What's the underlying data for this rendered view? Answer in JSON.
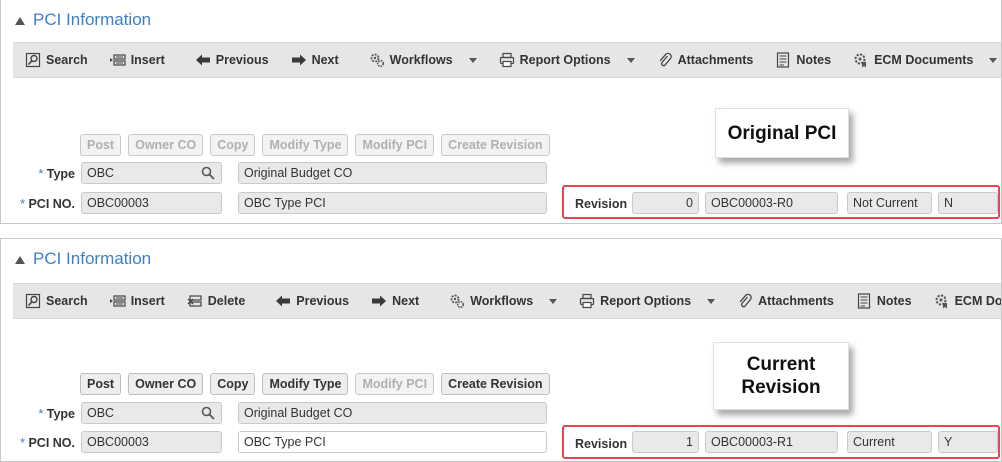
{
  "panels": [
    {
      "title": "PCI Information",
      "toolbar": [
        {
          "label": "Search",
          "icon": "search-icon"
        },
        {
          "label": "Insert",
          "icon": "insert-icon"
        },
        {
          "sep": true
        },
        {
          "label": "Previous",
          "icon": "arrow-left-icon"
        },
        {
          "label": "Next",
          "icon": "arrow-right-icon"
        },
        {
          "sep": true
        },
        {
          "label": "Workflows",
          "icon": "gears-icon",
          "caret": true
        },
        {
          "label": "Report Options",
          "icon": "printer-icon",
          "caret": true
        },
        {
          "label": "Attachments",
          "icon": "paperclip-icon"
        },
        {
          "label": "Notes",
          "icon": "notes-icon"
        },
        {
          "label": "ECM Documents",
          "icon": "ecm-icon",
          "caret": true
        }
      ],
      "buttons": [
        {
          "label": "Post",
          "enabled": false
        },
        {
          "label": "Owner CO",
          "enabled": false
        },
        {
          "label": "Copy",
          "enabled": false
        },
        {
          "label": "Modify Type",
          "enabled": false
        },
        {
          "label": "Modify PCI",
          "enabled": false
        },
        {
          "label": "Create Revision",
          "enabled": false
        }
      ],
      "type_label": "Type",
      "type_value": "OBC",
      "type_desc": "Original Budget CO",
      "pci_label": "PCI NO.",
      "pci_value": "OBC00003",
      "pci_desc": "OBC Type PCI",
      "revision_label": "Revision",
      "revision_number": "0",
      "revision_id": "OBC00003-R0",
      "revision_status": "Not Current",
      "revision_flag": "N",
      "callout": "Original PCI"
    },
    {
      "title": "PCI Information",
      "toolbar": [
        {
          "label": "Search",
          "icon": "search-icon"
        },
        {
          "label": "Insert",
          "icon": "insert-icon"
        },
        {
          "label": "Delete",
          "icon": "delete-icon"
        },
        {
          "sep": true
        },
        {
          "label": "Previous",
          "icon": "arrow-left-icon"
        },
        {
          "label": "Next",
          "icon": "arrow-right-icon"
        },
        {
          "sep": true
        },
        {
          "label": "Workflows",
          "icon": "gears-icon",
          "caret": true
        },
        {
          "label": "Report Options",
          "icon": "printer-icon",
          "caret": true
        },
        {
          "label": "Attachments",
          "icon": "paperclip-icon"
        },
        {
          "label": "Notes",
          "icon": "notes-icon"
        },
        {
          "label": "ECM Docu",
          "icon": "ecm-icon"
        }
      ],
      "buttons": [
        {
          "label": "Post",
          "enabled": true
        },
        {
          "label": "Owner CO",
          "enabled": true
        },
        {
          "label": "Copy",
          "enabled": true
        },
        {
          "label": "Modify Type",
          "enabled": true
        },
        {
          "label": "Modify PCI",
          "enabled": false
        },
        {
          "label": "Create Revision",
          "enabled": true
        }
      ],
      "type_label": "Type",
      "type_value": "OBC",
      "type_desc": "Original Budget CO",
      "pci_label": "PCI NO.",
      "pci_value": "OBC00003",
      "pci_desc": "OBC Type PCI",
      "revision_label": "Revision",
      "revision_number": "1",
      "revision_id": "OBC00003-R1",
      "revision_status": "Current",
      "revision_flag": "Y",
      "callout": "Current Revision"
    }
  ],
  "colors": {
    "title": "#3e7fc9",
    "highlight": "#e8474f",
    "disabled_text": "#b0b0b0"
  }
}
